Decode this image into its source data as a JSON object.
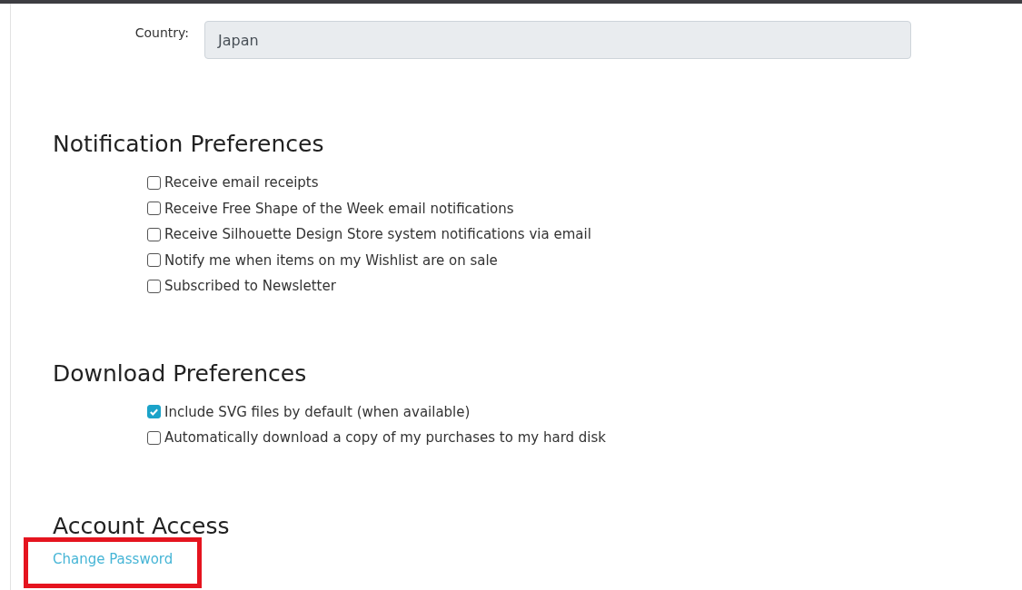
{
  "country": {
    "label": "Country:",
    "value": "Japan"
  },
  "sections": [
    {
      "title": "Notification Preferences",
      "options": [
        {
          "label": "Receive email receipts",
          "checked": false
        },
        {
          "label": "Receive Free Shape of the Week email notifications",
          "checked": false
        },
        {
          "label": "Receive Silhouette Design Store system notifications via email",
          "checked": false
        },
        {
          "label": "Notify me when items on my Wishlist are on sale",
          "checked": false
        },
        {
          "label": "Subscribed to Newsletter",
          "checked": false
        }
      ]
    },
    {
      "title": "Download Preferences",
      "options": [
        {
          "label": "Include SVG files by default (when available)",
          "checked": true
        },
        {
          "label": "Automatically download a copy of my purchases to my hard disk",
          "checked": false
        }
      ]
    }
  ],
  "account_access": {
    "title": "Account Access",
    "link": {
      "label": "Change Password",
      "highlighted": true
    }
  }
}
